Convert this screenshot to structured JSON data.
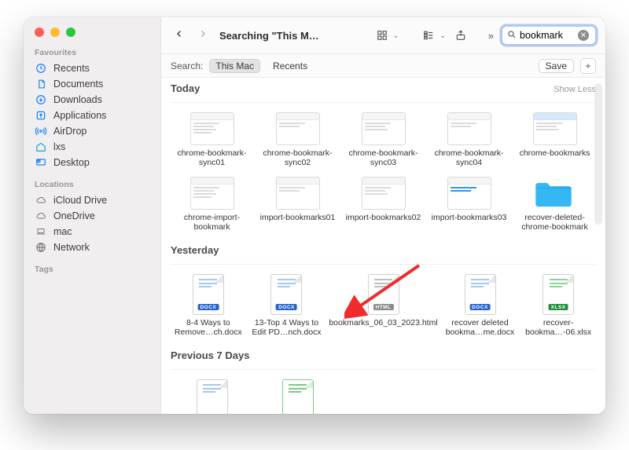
{
  "window_title": "Searching \"This M…",
  "traffic": {
    "close": "close",
    "min": "minimize",
    "max": "zoom"
  },
  "sidebar": {
    "groups": [
      {
        "label": "Favourites",
        "items": [
          {
            "icon": "clock-icon",
            "label": "Recents"
          },
          {
            "icon": "doc-icon",
            "label": "Documents"
          },
          {
            "icon": "download-icon",
            "label": "Downloads"
          },
          {
            "icon": "app-icon",
            "label": "Applications"
          },
          {
            "icon": "airdrop-icon",
            "label": "AirDrop"
          },
          {
            "icon": "home-icon",
            "label": "lxs"
          },
          {
            "icon": "desktop-icon",
            "label": "Desktop"
          }
        ]
      },
      {
        "label": "Locations",
        "items": [
          {
            "icon": "cloud-icon",
            "label": "iCloud Drive"
          },
          {
            "icon": "cloud-icon",
            "label": "OneDrive"
          },
          {
            "icon": "laptop-icon",
            "label": "mac"
          },
          {
            "icon": "globe-icon",
            "label": "Network"
          }
        ]
      },
      {
        "label": "Tags",
        "items": []
      }
    ]
  },
  "toolbar": {
    "back": "‹",
    "forward": "›",
    "view_icons": "icon-grid",
    "view_group": "group",
    "share": "share",
    "more": "»"
  },
  "search": {
    "value": "bookmark"
  },
  "scopebar": {
    "label": "Search:",
    "scopes": [
      "This Mac",
      "Recents"
    ],
    "selected_index": 0,
    "save": "Save",
    "plus": "+"
  },
  "sections": [
    {
      "title": "Today",
      "show_less": "Show Less",
      "items": [
        {
          "kind": "screenshot",
          "label": "chrome-bookmark-sync01"
        },
        {
          "kind": "screenshot",
          "label": "chrome-bookmark-sync02"
        },
        {
          "kind": "screenshot",
          "label": "chrome-bookmark-sync03"
        },
        {
          "kind": "screenshot",
          "label": "chrome-bookmark-sync04"
        },
        {
          "kind": "screenshot-blue",
          "label": "chrome-bookmarks"
        },
        {
          "kind": "screenshot",
          "label": "chrome-import-bookmark"
        },
        {
          "kind": "screenshot",
          "label": "import-bookmarks01"
        },
        {
          "kind": "screenshot",
          "label": "import-bookmarks02"
        },
        {
          "kind": "screenshot-bluecard",
          "label": "import-bookmarks03"
        },
        {
          "kind": "folder",
          "label": "recover-deleted-chrome-bookmark"
        }
      ]
    },
    {
      "title": "Yesterday",
      "items": [
        {
          "kind": "docx",
          "label": "8-4 Ways to Remove…ch.docx"
        },
        {
          "kind": "docx",
          "label": "13-Top 4 Ways to Edit PD…nch.docx"
        },
        {
          "kind": "html",
          "label": "bookmarks_06_03_2023.html"
        },
        {
          "kind": "docx",
          "label": "recover deleted bookma…me.docx"
        },
        {
          "kind": "xlsx",
          "label": "recover-bookma…-06.xlsx"
        }
      ]
    },
    {
      "title": "Previous 7 Days",
      "items": [
        {
          "kind": "docx-plain",
          "label": ""
        },
        {
          "kind": "spreadsheet",
          "label": ""
        }
      ]
    }
  ]
}
